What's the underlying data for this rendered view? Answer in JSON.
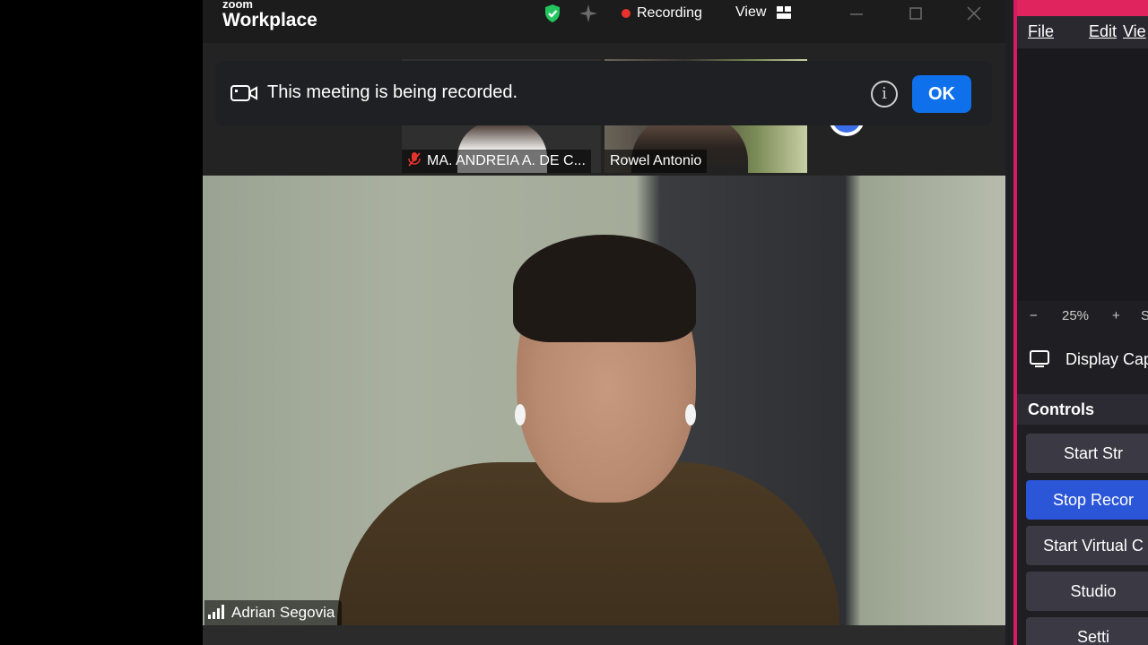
{
  "zoom": {
    "logo_small": "zoom",
    "logo_big": "Workplace",
    "recording_label": "Recording",
    "view_label": "View",
    "colors": {
      "accent": "#0e71eb",
      "recording": "#e8332c",
      "shield": "#22c55e"
    },
    "banner": {
      "text": "This meeting is being recorded.",
      "info_glyph": "i",
      "ok_label": "OK"
    },
    "participants": [
      {
        "name": "MA. ANDREIA A. DE C...",
        "muted": true
      },
      {
        "name": "Rowel Antonio",
        "muted": false
      }
    ],
    "active_speaker": "Adrian Segovia"
  },
  "obs": {
    "menu": [
      "File",
      "Edit",
      "Vie"
    ],
    "zoom_minus": "−",
    "zoom_level": "25%",
    "zoom_plus": "+",
    "zoom_extra": "S",
    "source_label": "Display Cap",
    "controls_header": "Controls",
    "buttons": [
      {
        "label": "Start Str",
        "active": false
      },
      {
        "label": "Stop Recor",
        "active": true
      },
      {
        "label": "Start Virtual C",
        "active": false
      },
      {
        "label": "Studio",
        "active": false
      },
      {
        "label": "Setti",
        "active": false
      }
    ],
    "colors": {
      "title_bar": "#e0245e",
      "active_button": "#2c56d8"
    }
  }
}
